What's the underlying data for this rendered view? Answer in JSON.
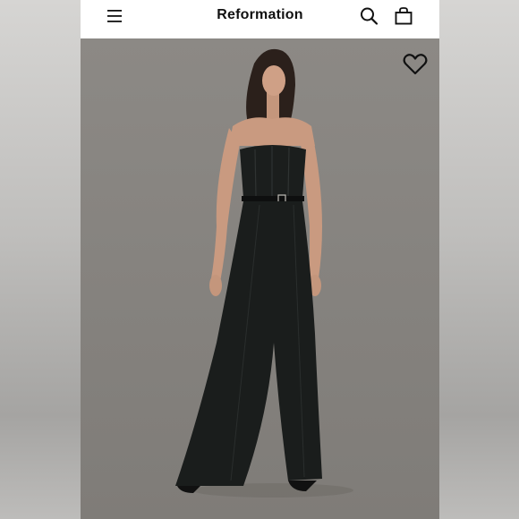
{
  "header": {
    "brand": "Reformation",
    "icons": [
      "menu-icon",
      "search-icon",
      "bag-icon"
    ]
  },
  "product": {
    "favorite_icon": "heart-icon"
  },
  "colors": {
    "header_bg": "#ffffff",
    "photo_bg": "#8b8884",
    "garment": "#1a1d1c",
    "icon": "#111111"
  }
}
